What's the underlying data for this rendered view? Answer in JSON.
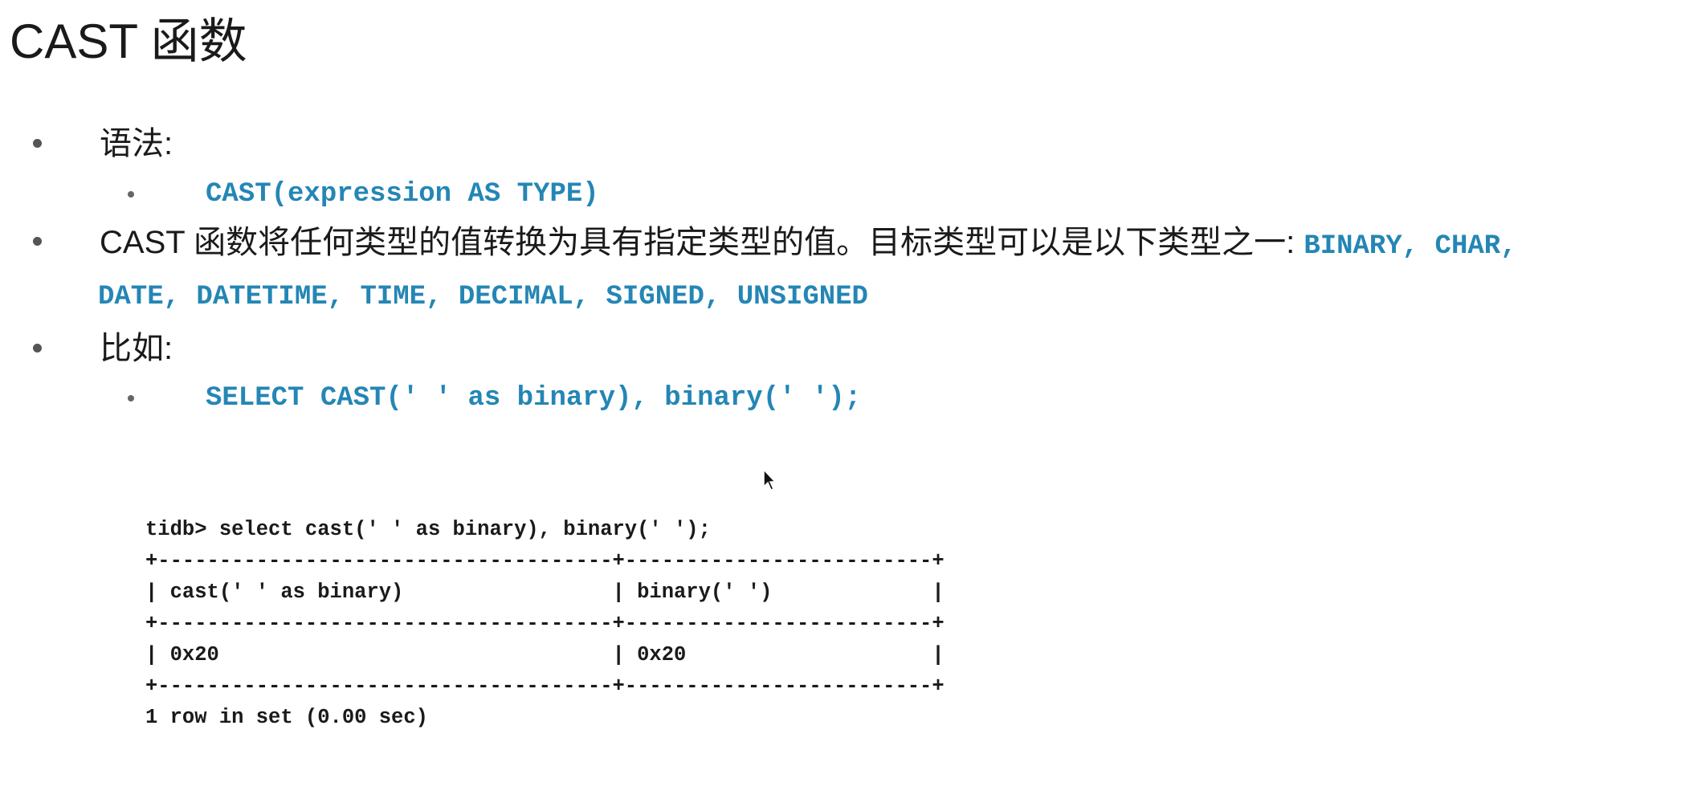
{
  "title": "CAST 函数",
  "bullets": {
    "syntax_label": "语法:",
    "syntax_code": "CAST(expression AS TYPE)",
    "description_text": "CAST 函数将任何类型的值转换为具有指定类型的值。目标类型可以是以下类型之一:",
    "description_types_line1": "BINARY, CHAR,",
    "description_types_line2": "DATE, DATETIME, TIME, DECIMAL, SIGNED, UNSIGNED",
    "example_label": "比如:",
    "example_code": "SELECT CAST(' ' as binary), binary(' ');"
  },
  "terminal": {
    "prompt_line": "tidb> select cast(' ' as binary), binary(' ');",
    "border_line": "+-------------------------------------+-------------------------+",
    "header_row": "| cast(' ' as binary)                 | binary(' ')             |",
    "value_row": "| 0x20                                | 0x20                    |",
    "footer": "1 row in set (0.00 sec)"
  },
  "icons": {
    "cursor": "mouse-pointer-icon"
  }
}
